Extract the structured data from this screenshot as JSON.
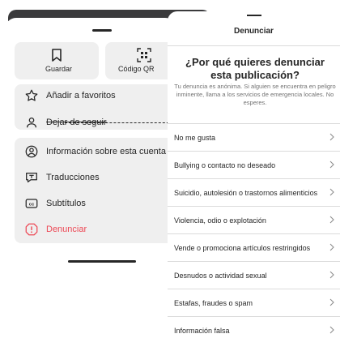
{
  "options_sheet": {
    "quick_actions": [
      {
        "label": "Guardar",
        "icon": "bookmark-icon"
      },
      {
        "label": "Código QR",
        "icon": "qr-code-icon"
      }
    ],
    "items": [
      {
        "label": "Añadir a favoritos",
        "icon": "star-icon"
      },
      {
        "label": "Dejar de seguir",
        "icon": "unfollow-icon"
      },
      {
        "label": "Información sobre esta cuenta",
        "icon": "account-info-icon"
      },
      {
        "label": "Traducciones",
        "icon": "translate-icon"
      },
      {
        "label": "Subtítulos",
        "icon": "captions-icon"
      },
      {
        "label": "Denunciar",
        "icon": "report-icon"
      }
    ]
  },
  "report_sheet": {
    "title": "Denunciar",
    "question": "¿Por qué quieres denunciar esta publicación?",
    "subtext": "Tu denuncia es anónima. Si alguien se encuentra en peligro inminente, llama a los servicios de emergencia locales. No esperes.",
    "reasons": [
      "No me gusta",
      "Bullying o contacto no deseado",
      "Suicidio, autolesión o trastornos alimenticios",
      "Violencia, odio o explotación",
      "Vende o promociona artículos restringidos",
      "Desnudos o actividad sexual",
      "Estafas, fraudes o spam",
      "Información falsa"
    ]
  },
  "colors": {
    "report_red": "#ed4956",
    "card_bg": "#efefef",
    "divider": "#dbdbdb",
    "text": "#262626",
    "muted": "#737373"
  }
}
